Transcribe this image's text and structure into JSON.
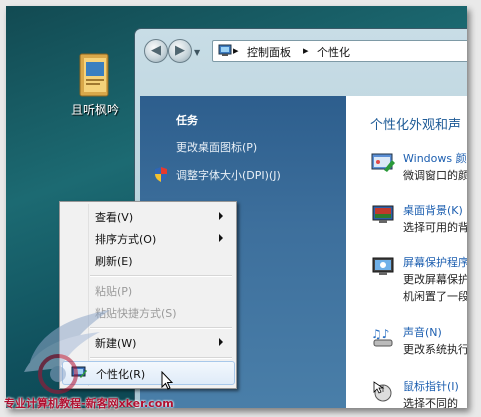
{
  "desktop": {
    "icon_label": "且听枫吟"
  },
  "window": {
    "breadcrumb": [
      "控制面板",
      "个性化"
    ],
    "breadcrumb_sep": "▸",
    "tasks": {
      "heading": "任务",
      "links": [
        "更改桌面图标(P)",
        "调整字体大小(DPI)(J)"
      ]
    },
    "content": {
      "title": "个性化外观和声",
      "items": [
        {
          "name": "Windows 颜",
          "desc": "微调窗口的颜",
          "icon": "window-color-icon"
        },
        {
          "name": "桌面背景(K)",
          "desc": "选择可用的背",
          "icon": "desktop-background-icon"
        },
        {
          "name": "屏幕保护程序",
          "desc": "更改屏幕保护",
          "desc2": "机闲置了一段",
          "icon": "screensaver-icon"
        },
        {
          "name": "声音(N)",
          "desc": "更改系统执行",
          "icon": "sound-icon"
        },
        {
          "name": "鼠标指针(I)",
          "desc": "选择不同的",
          "icon": "mouse-pointer-icon"
        }
      ]
    }
  },
  "context_menu": {
    "items": [
      {
        "label": "查看(V)",
        "submenu": true,
        "disabled": false
      },
      {
        "label": "排序方式(O)",
        "submenu": true,
        "disabled": false
      },
      {
        "label": "刷新(E)",
        "submenu": false,
        "disabled": false
      },
      {
        "label": "粘贴(P)",
        "submenu": false,
        "disabled": true
      },
      {
        "label": "粘贴快捷方式(S)",
        "submenu": false,
        "disabled": true
      },
      {
        "label": "新建(W)",
        "submenu": true,
        "disabled": false
      },
      {
        "label": "个性化(R)",
        "submenu": false,
        "disabled": false,
        "highlighted": true
      }
    ]
  },
  "watermark": {
    "text": "专业计算机教程-新客网xker.com"
  },
  "colors": {
    "desktop": "#1c6a72",
    "task_pane": "#3d6f9c",
    "link_blue": "#1d5fb0",
    "watermark_red": "#b01030"
  }
}
